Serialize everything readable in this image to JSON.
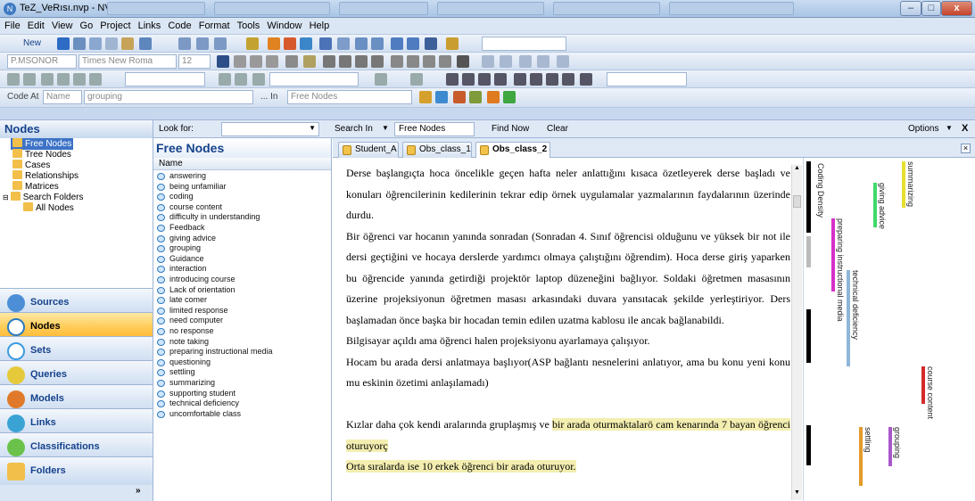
{
  "window": {
    "title": "TeZ_VeRısı.nvp - NVivo",
    "controls": {
      "minimize": "–",
      "maximize": "□",
      "close": "x"
    }
  },
  "menu": [
    "File",
    "Edit",
    "View",
    "Go",
    "Project",
    "Links",
    "Code",
    "Format",
    "Tools",
    "Window",
    "Help"
  ],
  "toolbar": {
    "new_label": "New",
    "style_combo": "P.MSONOR",
    "font_combo": "Times New Roma",
    "size_combo": "12"
  },
  "codebar": {
    "code_at_label": "Code At",
    "name_combo": "Name",
    "grouping_combo": "grouping",
    "in_label": "... In",
    "free_nodes_combo": "Free Nodes"
  },
  "findbar": {
    "panel_title": "Nodes",
    "look_for_label": "Look for:",
    "search_in_label": "Search In",
    "search_in_value": "Free Nodes",
    "find_now": "Find Now",
    "clear": "Clear",
    "options": "Options",
    "close_x": "X"
  },
  "tree": [
    {
      "label": "Free Nodes",
      "selected": true,
      "indent": 1
    },
    {
      "label": "Tree Nodes",
      "indent": 1
    },
    {
      "label": "Cases",
      "indent": 1
    },
    {
      "label": "Relationships",
      "indent": 1
    },
    {
      "label": "Matrices",
      "indent": 1
    },
    {
      "label": "Search Folders",
      "indent": 0
    },
    {
      "label": "All Nodes",
      "indent": 2
    }
  ],
  "nav": [
    {
      "label": "Sources"
    },
    {
      "label": "Nodes",
      "active": true
    },
    {
      "label": "Sets"
    },
    {
      "label": "Queries"
    },
    {
      "label": "Models"
    },
    {
      "label": "Links"
    },
    {
      "label": "Classifications"
    },
    {
      "label": "Folders"
    }
  ],
  "free_nodes": {
    "title": "Free Nodes",
    "column": "Name",
    "items": [
      "answering",
      "being unfamiliar",
      "coding",
      "course content",
      "difficulty in understanding",
      "Feedback",
      "giving advice",
      "grouping",
      "Guidance",
      "interaction",
      "introducing course",
      "Lack of orientation",
      "late comer",
      "limited response",
      "need computer",
      "no response",
      "note taking",
      "preparing instructional media",
      "questioning",
      "settling",
      "summarizing",
      "supporting student",
      "technical deficiency",
      "uncomfortable class"
    ]
  },
  "doc_tabs": [
    {
      "label": "Student_A"
    },
    {
      "label": "Obs_class_1"
    },
    {
      "label": "Obs_class_2",
      "active": true
    }
  ],
  "document": {
    "paragraphs": [
      {
        "parts": [
          {
            "text": "Derse başlangıçta hoca öncelikle geçen hafta neler anlattığını kısaca özetleyerek derse başladı ve konuları öğrencilerinin kedilerinin tekrar edip örnek uygulamalar yazmalarının faydalarının üzerinde durdu."
          }
        ]
      },
      {
        "parts": [
          {
            "text": "Bir öğrenci var hocanın yanında sonradan (Sonradan 4. Sınıf öğrencisi olduğunu ve yüksek bir not ile dersi geçtiğini ve hocaya derslerde yardımcı olmaya çalıştığını öğrendim). Hoca derse giriş yaparken bu öğrencide yanında getirdiği projektör laptop düzeneğini bağlıyor. Soldaki öğretmen masasının üzerine projeksiyonun öğretmen masası arkasındaki duvara yansıtacak şekilde yerleştiriyor. Ders başlamadan önce başka bir hocadan temin edilen uzatma kablosu ile ancak bağlanabildi."
          }
        ]
      },
      {
        "parts": [
          {
            "text": "Bilgisayar açıldı ama öğrenci halen projeksiyonu ayarlamaya çalışıyor."
          }
        ]
      },
      {
        "parts": [
          {
            "text": "Hocam bu arada dersi anlatmaya başlıyor(ASP bağlantı nesnelerini anlatıyor, ama bu konu yeni konu mu eskinin özetimi anlaşılamadı)"
          }
        ]
      },
      {
        "parts": [
          {
            "text": ""
          }
        ]
      },
      {
        "parts": [
          {
            "text": "Kızlar daha çok kendi aralarında gruplaşmış ve "
          },
          {
            "text": "bir arada oturmaktalarö cam kenarında 7 bayan öğrenci oturuyorç",
            "hl": true
          }
        ]
      },
      {
        "parts": [
          {
            "text": "Orta sıralarda ise 10 erkek öğrenci bir arada oturuyor.",
            "hl": true
          }
        ]
      }
    ]
  },
  "coding_strip": {
    "title": "Coding Density",
    "stripes": [
      {
        "label": "summarizing",
        "color": "#e6df2e"
      },
      {
        "label": "giving advice",
        "color": "#3fd96b"
      },
      {
        "label": "preparing instructional media",
        "color": "#d630c8"
      },
      {
        "label": "technical deficiency",
        "color": "#8fb6d8"
      },
      {
        "label": "course content",
        "color": "#d42a2a"
      },
      {
        "label": "settling",
        "color": "#e39a2c"
      },
      {
        "label": "grouping",
        "color": "#a858c9"
      }
    ]
  }
}
